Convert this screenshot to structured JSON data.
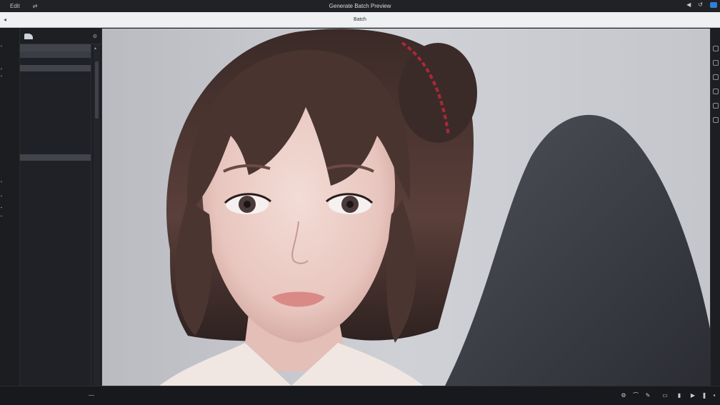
{
  "menubar": {
    "items": [
      "Edit"
    ],
    "title": "Generate Batch Preview",
    "right": [
      "◀",
      "↺"
    ]
  },
  "addressbar": {
    "nav": "◂",
    "url": "Batch"
  },
  "panel": {
    "opt_icon": "settings-icon",
    "scroll_up": "▴"
  },
  "colors": {
    "accent": "#2f7fd8",
    "sidebar_bg": "#1e1f23",
    "canvas_bg": "#c7c9ce"
  },
  "icons": {
    "folder": "folder-icon",
    "right_tools": [
      "zoom-icon",
      "hand-icon",
      "crop-icon",
      "brush-icon",
      "eraser-icon",
      "layers-icon"
    ],
    "bottom_tools": [
      "gear-icon",
      "curve-icon",
      "pen-icon",
      "frame-icon",
      "phone-icon",
      "play-icon",
      "pause-icon",
      "grid-icon"
    ]
  }
}
